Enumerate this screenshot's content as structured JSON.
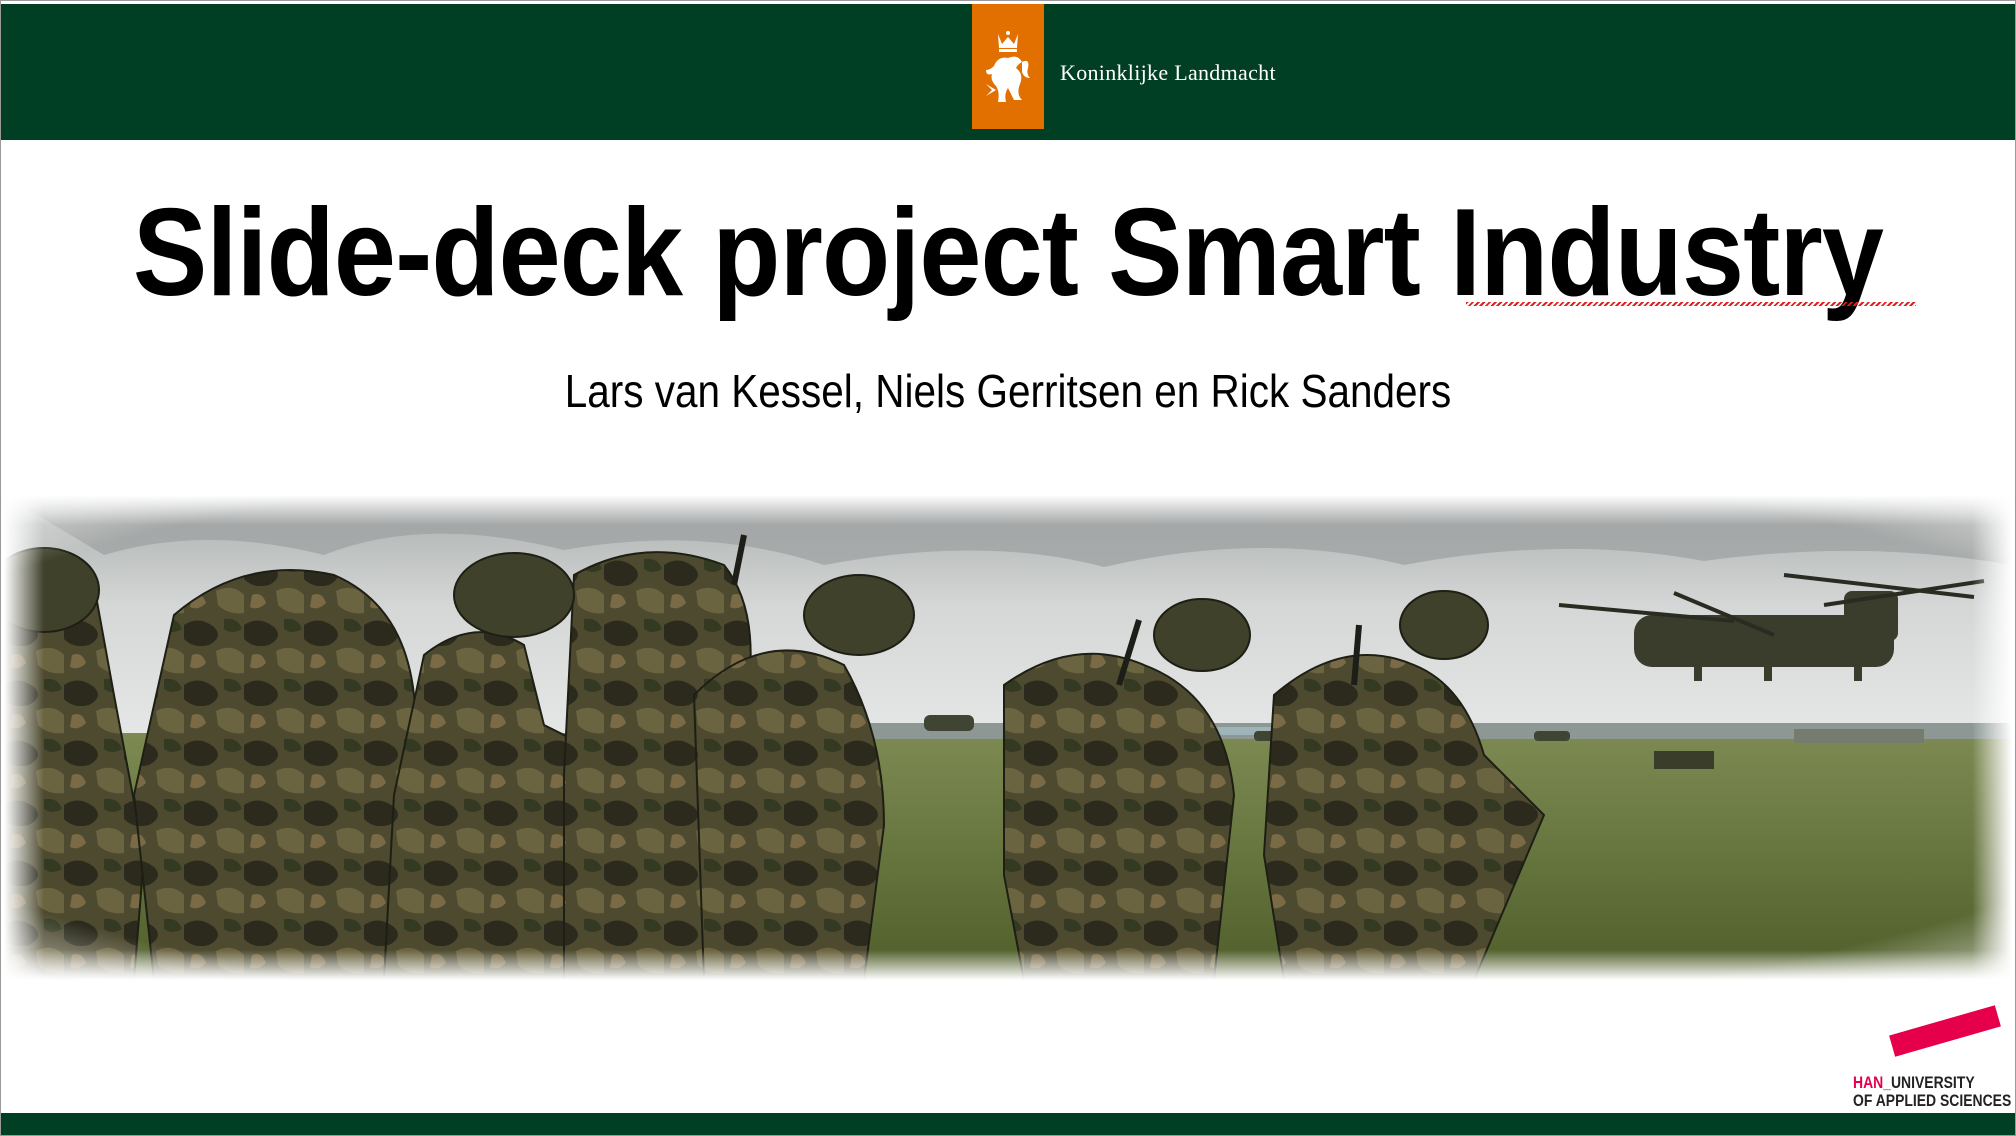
{
  "header": {
    "brand": "Koninklijke Landmacht",
    "emblem_icon": "crowned-lion-icon",
    "bar_color": "#003f23",
    "emblem_color": "#e17000"
  },
  "slide": {
    "title": "Slide-deck project Smart Industry",
    "subtitle": "Lars van Kessel, Niels Gerritsen en Rick Sanders"
  },
  "photo": {
    "icon": "soldiers-helicopter-photo"
  },
  "footer_logo": {
    "han": "HAN_",
    "line1_rest": "UNIVERSITY",
    "line2": "OF APPLIED SCIENCES",
    "accent_color": "#e6004c"
  }
}
